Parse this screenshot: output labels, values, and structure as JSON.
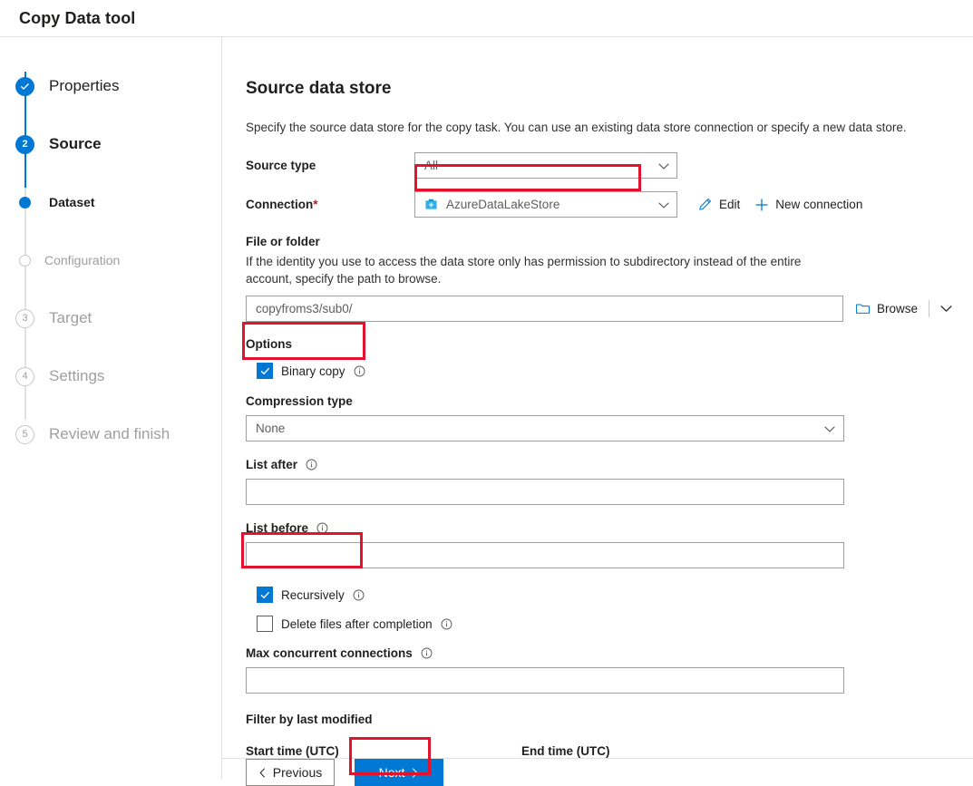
{
  "window": {
    "title": "Copy Data tool"
  },
  "stepper": {
    "items": [
      {
        "label": "Properties",
        "marker": "check-icon",
        "state": "done"
      },
      {
        "label": "Source",
        "marker": "2",
        "state": "current"
      },
      {
        "label": "Dataset",
        "marker": "dot-icon",
        "state": "current-sub"
      },
      {
        "label": "Configuration",
        "marker": "circle-icon",
        "state": "upcoming-sub"
      },
      {
        "label": "Target",
        "marker": "3",
        "state": "upcoming"
      },
      {
        "label": "Settings",
        "marker": "4",
        "state": "upcoming"
      },
      {
        "label": "Review and finish",
        "marker": "5",
        "state": "upcoming"
      }
    ]
  },
  "main": {
    "heading": "Source data store",
    "description": "Specify the source data store for the copy task. You can use an existing data store connection or specify a new data store.",
    "source_type": {
      "label": "Source type",
      "value": "All"
    },
    "connection": {
      "label": "Connection",
      "required_marker": "*",
      "value": "AzureDataLakeStore",
      "icon": "azure-data-lake-store-icon",
      "edit_label": "Edit",
      "new_connection_label": "New connection"
    },
    "file_or_folder": {
      "label": "File or folder",
      "help": "If the identity you use to access the data store only has permission to subdirectory instead of the entire account, specify the path to browse.",
      "value": "copyfroms3/sub0/",
      "placeholder": "",
      "browse_label": "Browse"
    },
    "options": {
      "label": "Options",
      "binary_copy": {
        "label": "Binary copy",
        "checked": true
      },
      "compression_type": {
        "label": "Compression type",
        "value": "None"
      },
      "list_after": {
        "label": "List after",
        "value": "",
        "placeholder": ""
      },
      "list_before": {
        "label": "List before",
        "value": "",
        "placeholder": ""
      },
      "recursively": {
        "label": "Recursively",
        "checked": true
      },
      "delete_files": {
        "label": "Delete files after completion",
        "checked": false
      },
      "max_concurrent_connections": {
        "label": "Max concurrent connections",
        "value": "",
        "placeholder": ""
      }
    },
    "filter": {
      "heading": "Filter by last modified",
      "start_time_label": "Start time (UTC)",
      "end_time_label": "End time (UTC)"
    }
  },
  "footer": {
    "previous_label": "Previous",
    "next_label": "Next"
  },
  "colors": {
    "accent": "#0078d4",
    "highlight": "#e2142d",
    "required": "#a4262c",
    "muted_text": "#a19f9d"
  }
}
